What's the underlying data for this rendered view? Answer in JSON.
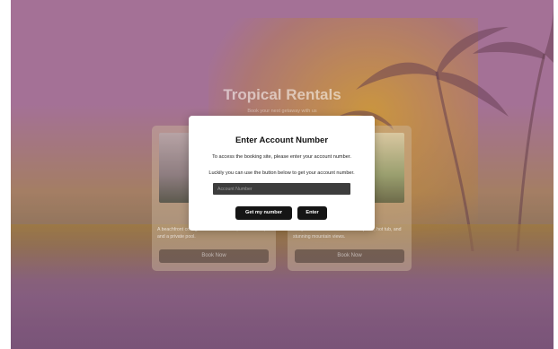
{
  "hero": {
    "title": "Tropical Rentals",
    "subtitle": "Book your next getaway with us"
  },
  "cards": [
    {
      "description": "A beachfront cottage with ocean views, 2 bedrooms, and a private pool.",
      "book_label": "Book Now"
    },
    {
      "description": "Cozy forest cabin with a stone fireplace, hot tub, and stunning mountain views.",
      "book_label": "Book Now"
    }
  ],
  "modal": {
    "title": "Enter Account Number",
    "instruction": "To access the booking site, please enter your account number.",
    "hint": "Luckily you can use the button below to get your account number.",
    "account_placeholder": "Account Number",
    "account_value": "",
    "get_button_label": "Get my number",
    "enter_button_label": "Enter"
  },
  "colors": {
    "modal_bg": "#ffffff",
    "button_bg": "#151515",
    "input_bg": "#3d3d3d",
    "tint_pink": "#c98ab7",
    "tint_gold": "#e3a23c"
  },
  "icons": [
    "palm-trees-illustration"
  ]
}
